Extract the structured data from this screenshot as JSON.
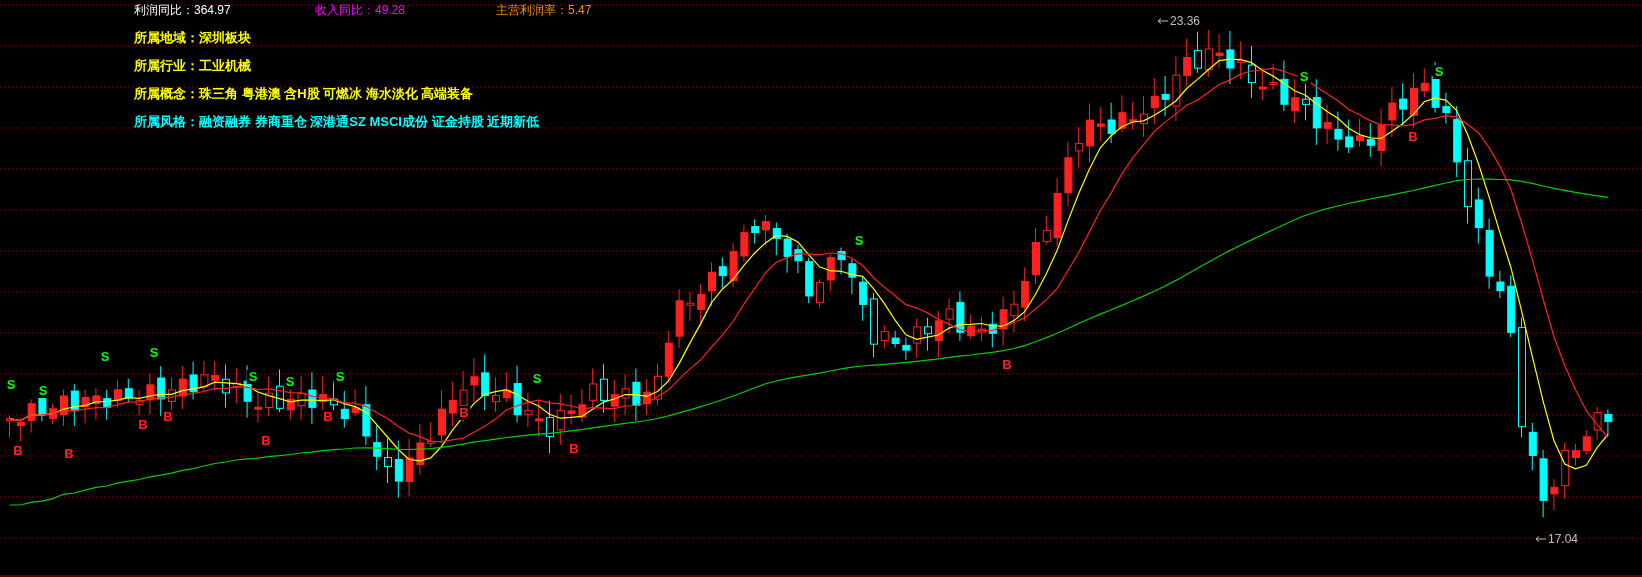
{
  "indicators": [
    {
      "label": "利润同比：",
      "value": "364.97",
      "color": "#ffffff"
    },
    {
      "label": "收入同比：",
      "value": "49.28",
      "color": "#ff00ff"
    },
    {
      "label": "主营利润率：",
      "value": "5.47",
      "color": "#ff8c00"
    }
  ],
  "info_rows": [
    {
      "label": "所属地域：",
      "value": "深圳板块",
      "color": "#ffff00"
    },
    {
      "label": "所属行业：",
      "value": "工业机械",
      "color": "#ffff00"
    },
    {
      "label": "所属概念：",
      "value": "珠三角 粤港澳 含H股 可燃冰 海水淡化 高端装备",
      "color": "#ffff00"
    },
    {
      "label": "所属风格：",
      "value": "融资融券 券商重仓 深港通SZ MSCI成份 证金持股 近期新低",
      "color": "#00ffff"
    }
  ],
  "chart": {
    "high_label": "23.36",
    "low_label": "17.04",
    "signals": [
      {
        "text": "S",
        "kind": "sell"
      },
      {
        "text": "B",
        "kind": "buy"
      },
      {
        "text": "S",
        "kind": "sell"
      },
      {
        "text": "B",
        "kind": "buy"
      },
      {
        "text": "S",
        "kind": "sell"
      },
      {
        "text": "B",
        "kind": "buy"
      },
      {
        "text": "S",
        "kind": "sell"
      },
      {
        "text": "B",
        "kind": "buy"
      },
      {
        "text": "S",
        "kind": "sell"
      },
      {
        "text": "B",
        "kind": "buy"
      },
      {
        "text": "S",
        "kind": "sell"
      },
      {
        "text": "B",
        "kind": "buy"
      },
      {
        "text": "S",
        "kind": "sell"
      },
      {
        "text": "B",
        "kind": "buy"
      },
      {
        "text": "S",
        "kind": "sell"
      },
      {
        "text": "B",
        "kind": "buy"
      },
      {
        "text": "S",
        "kind": "sell"
      },
      {
        "text": "B",
        "kind": "buy"
      },
      {
        "text": "S",
        "kind": "sell"
      },
      {
        "text": "B",
        "kind": "buy"
      },
      {
        "text": "S",
        "kind": "sell"
      }
    ]
  }
}
